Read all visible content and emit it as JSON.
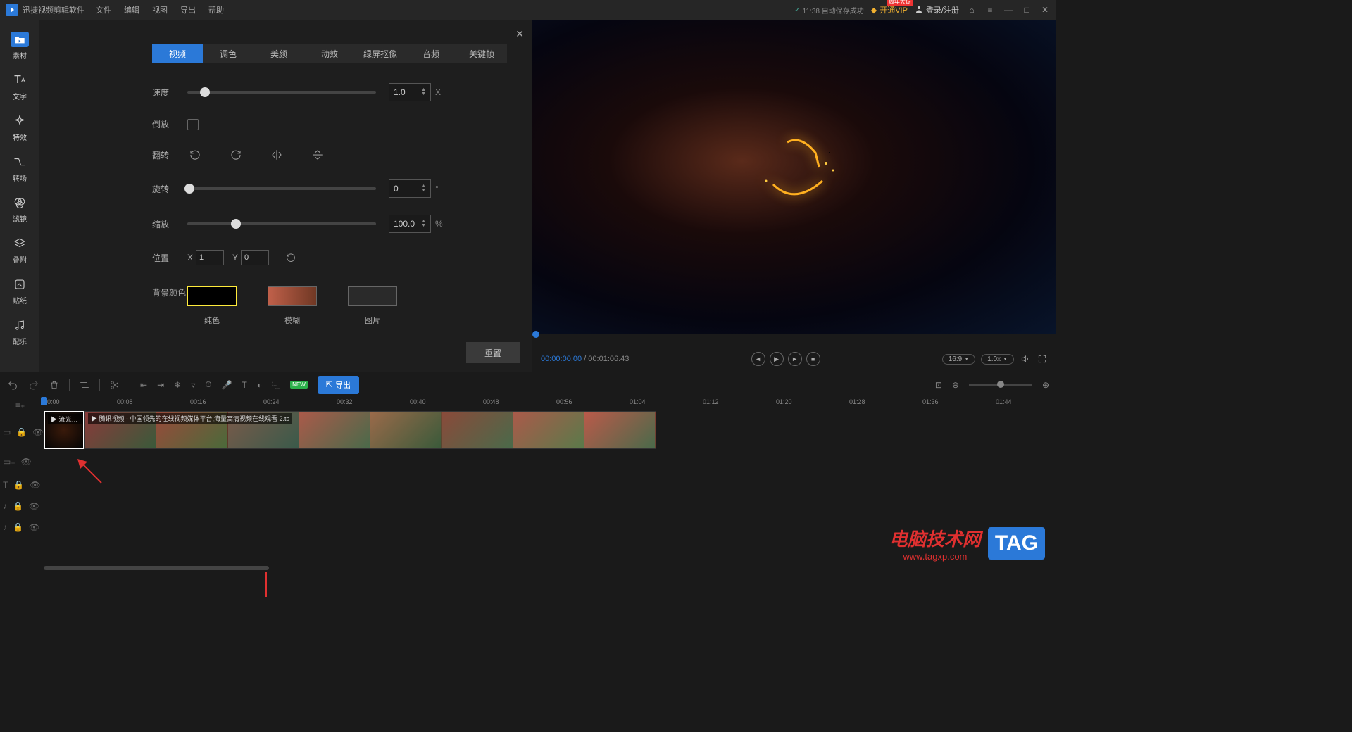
{
  "app": {
    "title": "迅捷视频剪辑软件"
  },
  "menu": [
    "文件",
    "编辑",
    "视图",
    "导出",
    "帮助"
  ],
  "titlebar": {
    "autosave_check": "✓",
    "autosave": "11:38 自动保存成功",
    "vip": "开通VIP",
    "vip_badge": "周年大促",
    "login": "登录/注册"
  },
  "sidebar": [
    {
      "label": "素材"
    },
    {
      "label": "文字"
    },
    {
      "label": "特效"
    },
    {
      "label": "转场"
    },
    {
      "label": "滤镜"
    },
    {
      "label": "叠附"
    },
    {
      "label": "贴纸"
    },
    {
      "label": "配乐"
    }
  ],
  "props": {
    "tabs": [
      "视频",
      "调色",
      "美颜",
      "动效",
      "绿屏抠像",
      "音频",
      "关键帧"
    ],
    "speed_label": "速度",
    "speed_value": "1.0",
    "speed_unit": "X",
    "reverse_label": "倒放",
    "flip_label": "翻转",
    "rotate_label": "旋转",
    "rotate_value": "0",
    "rotate_unit": "°",
    "scale_label": "缩放",
    "scale_value": "100.0",
    "scale_unit": "%",
    "position_label": "位置",
    "pos_x_label": "X",
    "pos_x_value": "1",
    "pos_y_label": "Y",
    "pos_y_value": "0",
    "bg_label": "背景颜色",
    "bg_options": [
      "纯色",
      "模糊",
      "图片"
    ],
    "bg_colors": [
      "#000000",
      "linear-gradient(90deg,#c0604a,#703824)",
      "#2a2a2a"
    ],
    "reset": "重置"
  },
  "preview": {
    "current_time": "00:00:00.00",
    "sep": " / ",
    "total_time": "00:01:06.43",
    "ratio": "16:9",
    "rate": "1.0x"
  },
  "toolbar": {
    "new_badge": "NEW",
    "export": "导出"
  },
  "ruler": [
    "00:00",
    "00:08",
    "00:16",
    "00:24",
    "00:32",
    "00:40",
    "00:48",
    "00:56",
    "01:04",
    "01:12",
    "01:20",
    "01:28",
    "01:36",
    "01:44"
  ],
  "clips": [
    {
      "label": "▶ 流光倒..."
    },
    {
      "label": "▶ 腾讯视频 - 中国领先的在线视频媒体平台,海量高清视频在线观看 2.ts"
    }
  ],
  "watermark": {
    "text1": "电脑技术网",
    "text2": "www.tagxp.com",
    "tag": "TAG"
  }
}
